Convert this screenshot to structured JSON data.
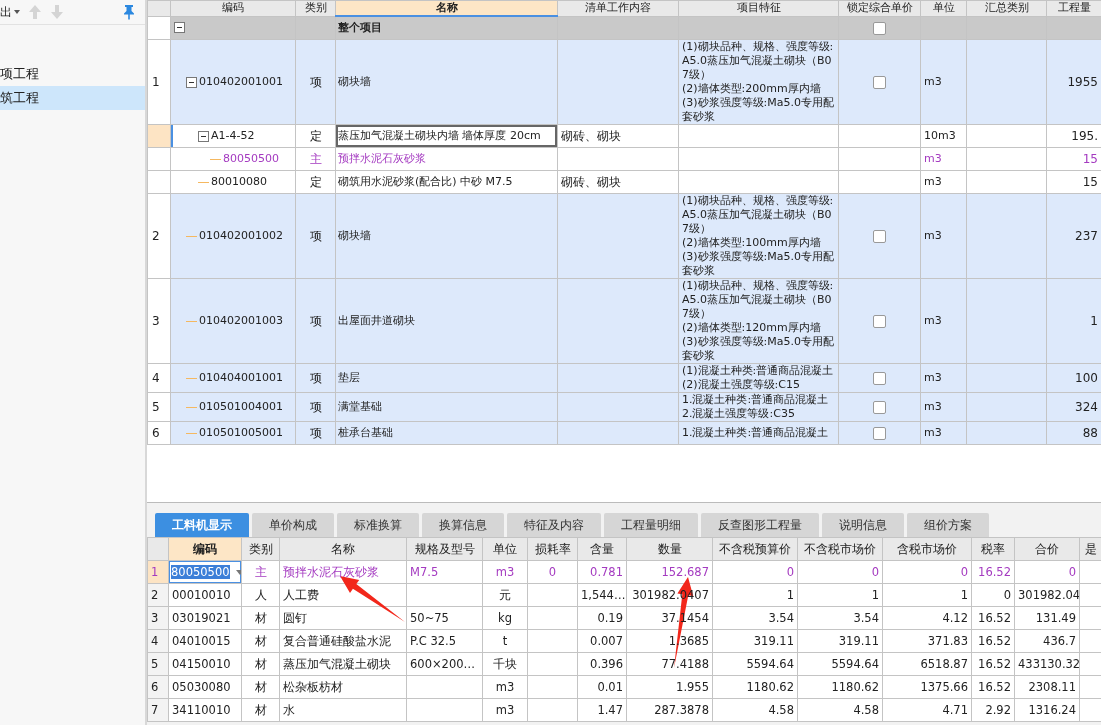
{
  "sidebar": {
    "toolbar": {
      "export_label": "出"
    },
    "items": [
      {
        "label": "项工程",
        "selected": false
      },
      {
        "label": "筑工程",
        "selected": true
      }
    ]
  },
  "top_grid": {
    "columns": [
      "编码",
      "类别",
      "名称",
      "清单工作内容",
      "项目特征",
      "锁定综合单价",
      "单位",
      "汇总类别",
      "工程量"
    ],
    "rows": [
      {
        "kind": "group",
        "name": "整个项目",
        "expanded": true,
        "lock": false,
        "selected": false,
        "children": [
          {
            "num": "1",
            "code": "010402001001",
            "kind": "item",
            "type": "项",
            "name": "砌块墙",
            "features": [
              "(1)砌块品种、规格、强度等级:A5.0蒸压加气混凝土砌块（B07级）",
              "(2)墙体类型:200mm厚内墙",
              "(3)砂浆强度等级:Ma5.0专用配套砂浆"
            ],
            "lock": false,
            "unit": "m3",
            "qty": "1955",
            "expanded": true,
            "selected": false,
            "children": [
              {
                "code": "A1-4-52",
                "kind": "quota",
                "type": "定",
                "name": "蒸压加气混凝土砌块内墙 墙体厚度 20cm",
                "work": "砌砖、砌块",
                "unit": "10m3",
                "qty": "195.",
                "expanded": true,
                "selected": true,
                "children": [
                  {
                    "code": "80050500",
                    "kind": "material",
                    "type": "主",
                    "name": "预拌水泥石灰砂浆",
                    "unit": "m3",
                    "qty": "15",
                    "selected": false
                  }
                ]
              },
              {
                "code": "80010080",
                "kind": "quota",
                "type": "定",
                "name": "砌筑用水泥砂浆(配合比) 中砂 M7.5",
                "work": "砌砖、砌块",
                "unit": "m3",
                "qty": "15",
                "selected": false
              }
            ]
          },
          {
            "num": "2",
            "code": "010402001002",
            "kind": "item",
            "type": "项",
            "name": "砌块墙",
            "features": [
              "(1)砌块品种、规格、强度等级:A5.0蒸压加气混凝土砌块（B07级）",
              "(2)墙体类型:100mm厚内墙",
              "(3)砂浆强度等级:Ma5.0专用配套砂浆"
            ],
            "lock": false,
            "unit": "m3",
            "qty": "237",
            "selected": false
          },
          {
            "num": "3",
            "code": "010402001003",
            "kind": "item",
            "type": "项",
            "name": "出屋面井道砌块",
            "features": [
              "(1)砌块品种、规格、强度等级:A5.0蒸压加气混凝土砌块（B07级）",
              "(2)墙体类型:120mm厚内墙",
              "(3)砂浆强度等级:Ma5.0专用配套砂浆"
            ],
            "lock": false,
            "unit": "m3",
            "qty": "1",
            "selected": false
          },
          {
            "num": "4",
            "code": "010404001001",
            "kind": "item",
            "type": "项",
            "name": "垫层",
            "features": [
              "(1)混凝土种类:普通商品混凝土",
              "(2)混凝土强度等级:C15"
            ],
            "lock": false,
            "unit": "m3",
            "qty": "100",
            "selected": false
          },
          {
            "num": "5",
            "code": "010501004001",
            "kind": "item",
            "type": "项",
            "name": "满堂基础",
            "features": [
              "1.混凝土种类:普通商品混凝土",
              "2.混凝土强度等级:C35"
            ],
            "lock": false,
            "unit": "m3",
            "qty": "324",
            "selected": false
          },
          {
            "num": "6",
            "code": "010501005001",
            "kind": "item",
            "type": "项",
            "name": "桩承台基础",
            "features": [
              "1.混凝土种类:普通商品混凝土"
            ],
            "lock": false,
            "unit": "m3",
            "qty": "88",
            "selected": false
          }
        ]
      }
    ]
  },
  "tabs": [
    {
      "label": "工料机显示",
      "selected": true
    },
    {
      "label": "单价构成",
      "selected": false
    },
    {
      "label": "标准换算",
      "selected": false
    },
    {
      "label": "换算信息",
      "selected": false
    },
    {
      "label": "特征及内容",
      "selected": false
    },
    {
      "label": "工程量明细",
      "selected": false
    },
    {
      "label": "反查图形工程量",
      "selected": false
    },
    {
      "label": "说明信息",
      "selected": false
    },
    {
      "label": "组价方案",
      "selected": false
    }
  ],
  "bottom_grid": {
    "columns": [
      {
        "label": "编码",
        "selected": true
      },
      {
        "label": "类别",
        "selected": false
      },
      {
        "label": "名称",
        "selected": false
      },
      {
        "label": "规格及型号",
        "selected": false
      },
      {
        "label": "单位",
        "selected": false
      },
      {
        "label": "损耗率",
        "selected": false
      },
      {
        "label": "含量",
        "selected": false
      },
      {
        "label": "数量",
        "selected": false
      },
      {
        "label": "不含税预算价",
        "selected": false
      },
      {
        "label": "不含税市场价",
        "selected": false
      },
      {
        "label": "含税市场价",
        "selected": false
      },
      {
        "label": "税率",
        "selected": false
      },
      {
        "label": "合价",
        "selected": false
      },
      {
        "label": "是",
        "selected": false
      }
    ],
    "rows": [
      {
        "num": "1",
        "kind": "main",
        "selected": true,
        "cells": [
          "80050500",
          "主",
          "预拌水泥石灰砂浆",
          "M7.5",
          "m3",
          "0",
          "0.781",
          "152.687",
          "0",
          "0",
          "0",
          "16.52",
          "0"
        ]
      },
      {
        "num": "2",
        "kind": "labor",
        "selected": false,
        "cells": [
          "00010010",
          "人",
          "人工费",
          "",
          "元",
          "",
          "1,544…",
          "301982.0407",
          "1",
          "1",
          "1",
          "0",
          "301982.04"
        ]
      },
      {
        "num": "3",
        "kind": "material",
        "selected": false,
        "cells": [
          "03019021",
          "材",
          "圆钉",
          "50~75",
          "kg",
          "",
          "0.19",
          "37.1454",
          "3.54",
          "3.54",
          "4.12",
          "16.52",
          "131.49"
        ]
      },
      {
        "num": "4",
        "kind": "material",
        "selected": false,
        "cells": [
          "04010015",
          "材",
          "复合普通硅酸盐水泥",
          "P.C 32.5",
          "t",
          "",
          "0.007",
          "1.3685",
          "319.11",
          "319.11",
          "371.83",
          "16.52",
          "436.7"
        ]
      },
      {
        "num": "5",
        "kind": "material",
        "selected": false,
        "cells": [
          "04150010",
          "材",
          "蒸压加气混凝土砌块",
          "600×200…",
          "千块",
          "",
          "0.396",
          "77.4188",
          "5594.64",
          "5594.64",
          "6518.87",
          "16.52",
          "433130.32"
        ]
      },
      {
        "num": "6",
        "kind": "material",
        "selected": false,
        "cells": [
          "05030080",
          "材",
          "松杂板枋材",
          "",
          "m3",
          "",
          "0.01",
          "1.955",
          "1180.62",
          "1180.62",
          "1375.66",
          "16.52",
          "2308.11"
        ]
      },
      {
        "num": "7",
        "kind": "material",
        "selected": false,
        "cells": [
          "34110010",
          "材",
          "水",
          "",
          "m3",
          "",
          "1.47",
          "287.3878",
          "4.58",
          "4.58",
          "4.71",
          "2.92",
          "1316.24"
        ]
      }
    ]
  }
}
